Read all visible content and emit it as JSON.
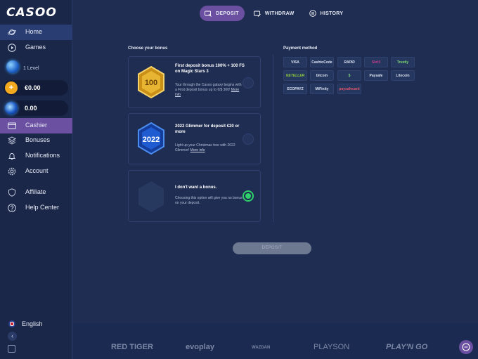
{
  "brand": {
    "logo_text": "CASOO"
  },
  "sidebar": {
    "items": [
      {
        "label": "Home",
        "icon": "planet-icon"
      },
      {
        "label": "Games",
        "icon": "play-icon"
      }
    ],
    "level_label": "1 Level",
    "balance_cash": "€0.00",
    "balance_coins": "0.00",
    "menu": [
      {
        "label": "Cashier",
        "icon": "card-icon"
      },
      {
        "label": "Bonuses",
        "icon": "layers-icon"
      },
      {
        "label": "Notifications",
        "icon": "bell-icon"
      },
      {
        "label": "Account",
        "icon": "gear-icon"
      },
      {
        "label": "Affiliate",
        "icon": "shield-icon"
      },
      {
        "label": "Help Center",
        "icon": "question-icon"
      }
    ],
    "language": "English",
    "coin_glyph": "+"
  },
  "tabs": [
    {
      "label": "DEPOSIT",
      "active": true
    },
    {
      "label": "WITHDRAW",
      "active": false
    },
    {
      "label": "HISTORY",
      "active": false
    }
  ],
  "bonus": {
    "section_title": "Choose your bonus",
    "cards": [
      {
        "title": "First deposit bonus 100% + 100 FS on Magic Stars 3",
        "desc": "Tour through the Casoo galaxy begins with a First deposit bonus up to €/$ 300!",
        "more": "More info",
        "badge": "100",
        "selected": false
      },
      {
        "title": "2022 Glimmer for deposit €20 or more",
        "desc": "Light up your Christmas tree with 2022 Glimmer!",
        "more": "More info",
        "badge": "2022",
        "selected": false
      },
      {
        "title": "I don't want a bonus.",
        "desc": "Choosing this option will give you no bonus on your deposit.",
        "more": "",
        "badge": "",
        "selected": true
      }
    ]
  },
  "payment": {
    "section_title": "Payment method",
    "methods": [
      "VISA",
      "CashtoCode",
      "RAPID",
      "Skrill",
      "Trustly",
      "NETELLER",
      "bitcoin",
      "$",
      "Paysafe",
      "Litecoin",
      "ECOPAYZ",
      "MiFinity",
      "paysafecard"
    ]
  },
  "deposit_button": "DEPOSIT",
  "providers": [
    "RED TIGER",
    "evoplay",
    "WAZDAN",
    "PLAYSON",
    "PLAY'N GO"
  ],
  "colors": {
    "accent": "#6b4fa1",
    "selected": "#2fd16a",
    "bg": "#1f2d52"
  }
}
